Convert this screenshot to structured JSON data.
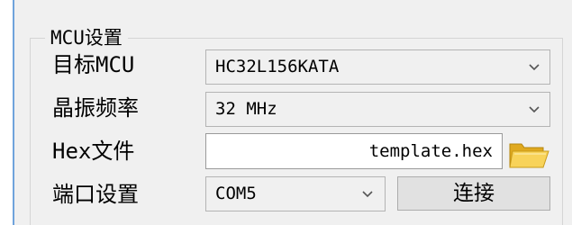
{
  "group": {
    "title": "MCU设置"
  },
  "rows": {
    "target_mcu": {
      "label": "目标MCU",
      "value": "HC32L156KATA"
    },
    "crystal": {
      "label": "晶振频率",
      "value": "32 MHz"
    },
    "hex_file": {
      "label": "Hex文件",
      "value": "template.hex"
    },
    "port": {
      "label": "端口设置",
      "value": "COM5",
      "connect_label": "连接"
    }
  },
  "icons": {
    "dropdown": "chevron-down-icon",
    "browse": "folder-open-icon"
  },
  "colors": {
    "accent": "#6fa3dc",
    "folder": "#f5c53b"
  }
}
